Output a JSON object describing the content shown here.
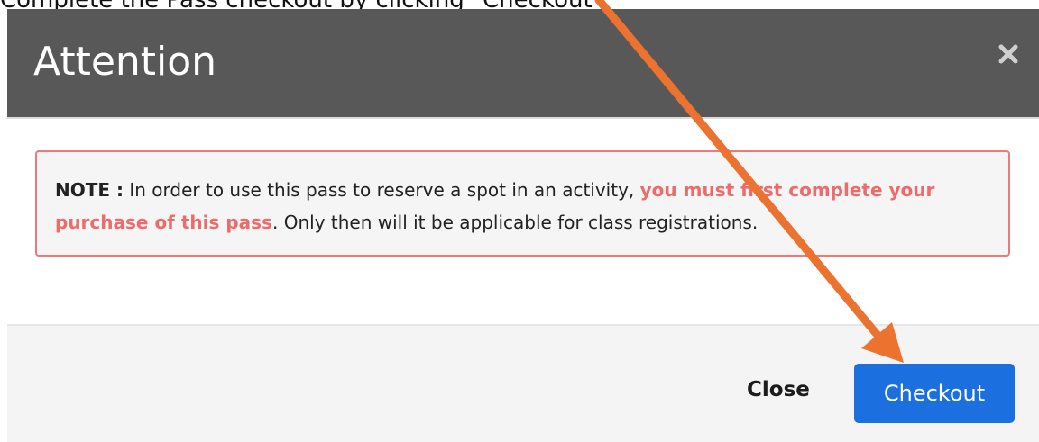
{
  "instruction": "Complete the Pass checkout by clicking \"Checkout\".",
  "modal": {
    "title": "Attention",
    "close_icon": "close-x-icon",
    "note": {
      "label": "NOTE :",
      "text_before": " In order to use this pass to reserve a spot in an activity, ",
      "highlight": "you must first complete your purchase of this pass",
      "text_after": ". Only then will it be applicable for class registrations."
    },
    "footer": {
      "close_label": "Close",
      "checkout_label": "Checkout"
    }
  },
  "annotation": {
    "arrow_icon": "orange-arrow-icon",
    "color": "#ec7230"
  },
  "colors": {
    "header_bg": "#585858",
    "note_border": "#ed7a7a",
    "note_highlight": "#ec6c6c",
    "primary_button": "#1c6fde"
  }
}
